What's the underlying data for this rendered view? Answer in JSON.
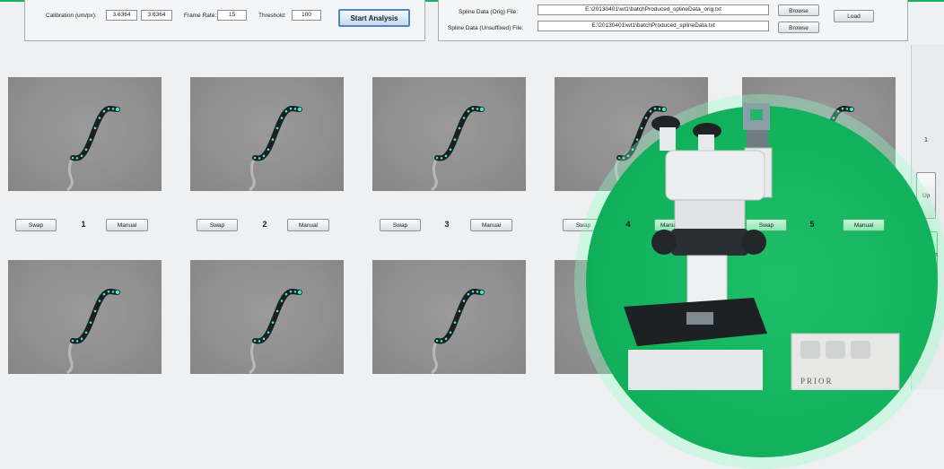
{
  "calibration": {
    "label": "Calibration (um/px):",
    "x_value": "3.6364",
    "y_value": "3.6364"
  },
  "frame_rate": {
    "label": "Frame Rate:",
    "value": "15"
  },
  "threshold": {
    "label": "Threshold:",
    "value": "100"
  },
  "start_button": {
    "label": "Start Analysis"
  },
  "spline_orig": {
    "label": "Spline Data (Orig) File:",
    "path": "E:\\20130401\\wt1\\batchProduced_splineData_orig.txt",
    "browse_label": "Browse"
  },
  "spline_unsuffixed": {
    "label": "Spline Data (Unsuffixed) File:",
    "path": "E:\\20130401\\wt1\\batchProduced_splineData.txt",
    "browse_label": "Browse"
  },
  "load_button": {
    "label": "Load"
  },
  "frame_controls": [
    {
      "number": "1",
      "swap_label": "Swap",
      "manual_label": "Manual"
    },
    {
      "number": "2",
      "swap_label": "Swap",
      "manual_label": "Manual"
    },
    {
      "number": "3",
      "swap_label": "Swap",
      "manual_label": "Manual"
    },
    {
      "number": "4",
      "swap_label": "Swap",
      "manual_label": "Manual"
    },
    {
      "number": "5",
      "swap_label": "Swap",
      "manual_label": "Manual"
    }
  ],
  "side": {
    "page_number": "1",
    "up_label": "Up",
    "down_label": "Down"
  },
  "overlay": {
    "device_brand": "PRIOR"
  },
  "colors": {
    "accent_green": "#19b35a",
    "start_button_border": "#4e86c6",
    "spline_point": "#3fe6d6",
    "thumbnail_gray": "#8f8f8f"
  }
}
